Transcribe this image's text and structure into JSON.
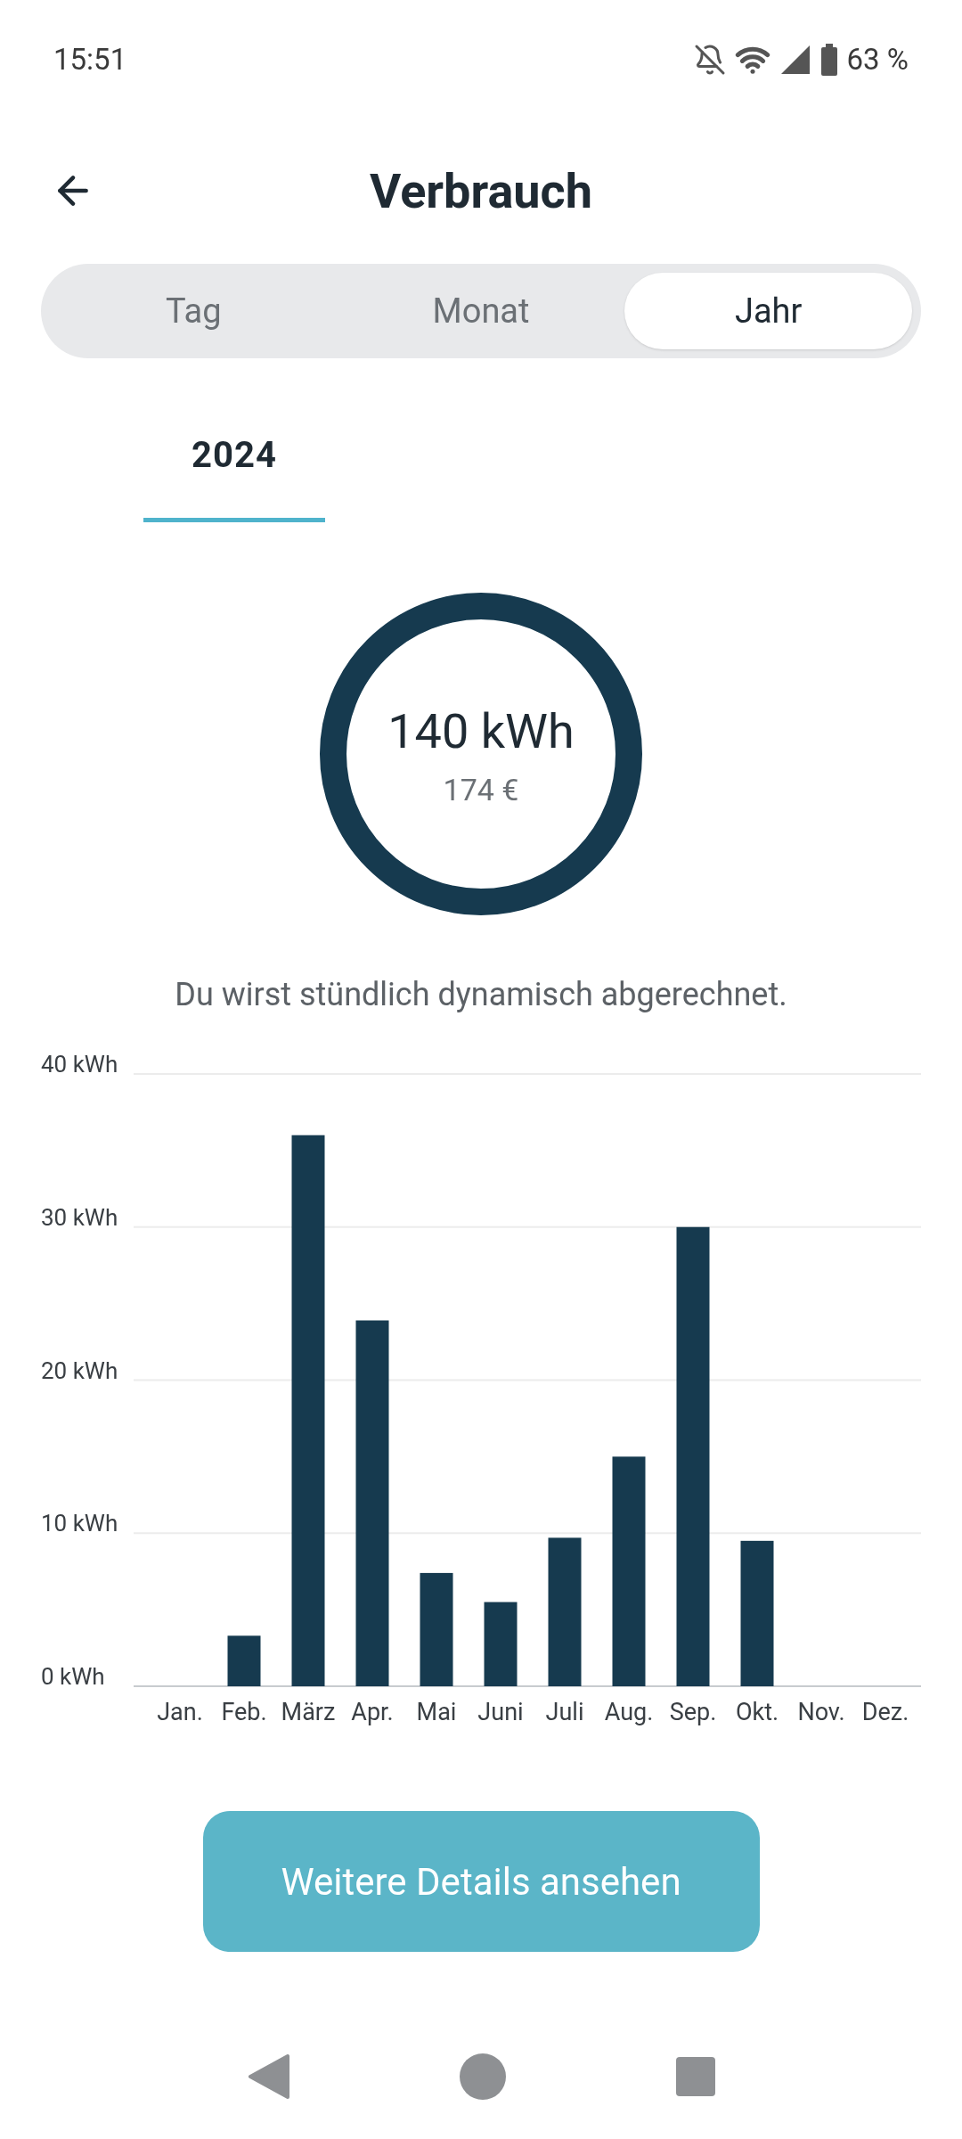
{
  "status_bar": {
    "time": "15:51",
    "battery": "63 %"
  },
  "header": {
    "title": "Verbrauch"
  },
  "segments": [
    {
      "label": "Tag",
      "selected": false
    },
    {
      "label": "Monat",
      "selected": false
    },
    {
      "label": "Jahr",
      "selected": true
    }
  ],
  "period_tabs": [
    {
      "label": "2024",
      "selected": true
    }
  ],
  "total": {
    "energy": "140 kWh",
    "cost": "174 €"
  },
  "note": "Du wirst stündlich dynamisch abgerechnet.",
  "chart": {
    "chart_data": {
      "type": "bar",
      "categories": [
        "Jan.",
        "Feb.",
        "März",
        "Apr.",
        "Mai",
        "Juni",
        "Juli",
        "Aug.",
        "Sep.",
        "Okt.",
        "Nov.",
        "Dez."
      ],
      "grid": true,
      "series": [
        {
          "color": "#163a4f",
          "values": [
            null,
            3.3,
            36,
            23.9,
            7.4,
            5.5,
            9.7,
            15,
            30,
            9.5,
            null,
            null
          ]
        }
      ],
      "ylim": [
        0,
        40
      ],
      "yticks": [
        {
          "value": 0,
          "label": "0 kWh"
        },
        {
          "value": 10,
          "label": "10 kWh"
        },
        {
          "value": 20,
          "label": "20 kWh"
        },
        {
          "value": 30,
          "label": "30 kWh"
        },
        {
          "value": 40,
          "label": "40 kWh"
        }
      ]
    }
  },
  "details_button": {
    "label": "Weitere Details ansehen"
  }
}
